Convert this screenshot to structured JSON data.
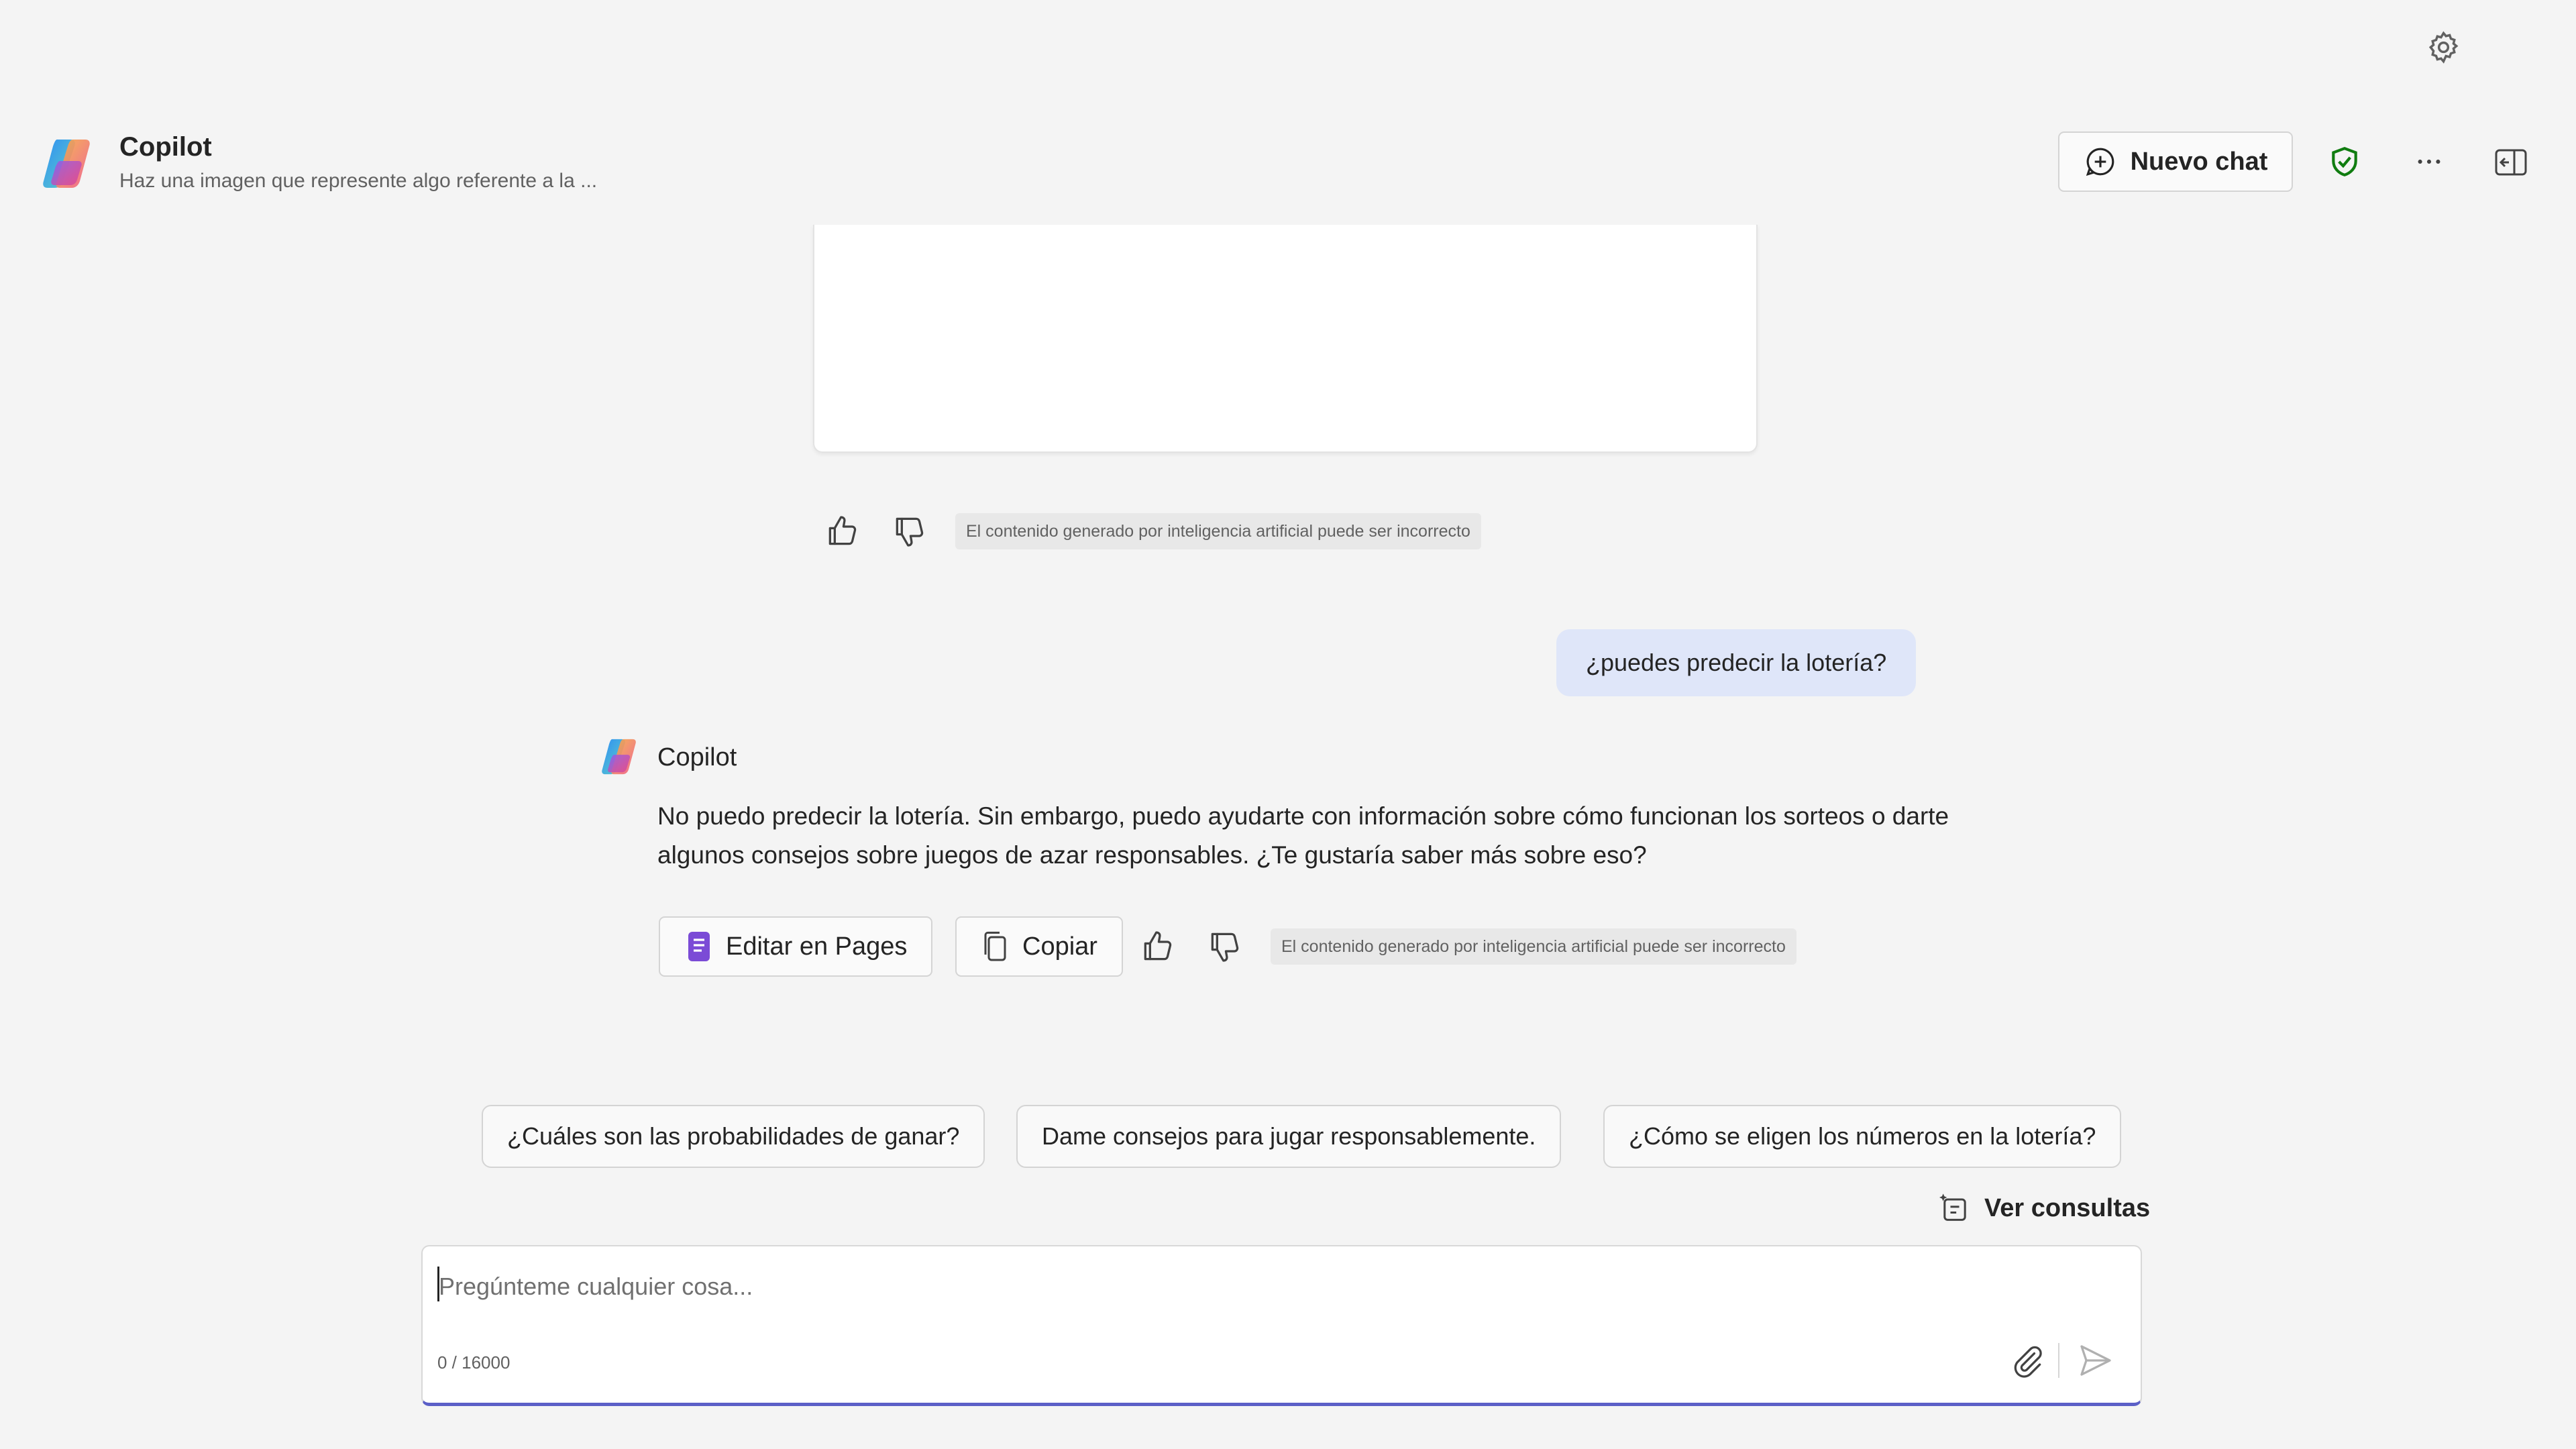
{
  "header": {
    "app_title": "Copilot",
    "subtitle": "Haz una imagen que represente algo referente a la ...",
    "new_chat_label": "Nuevo chat"
  },
  "previous_feedback": {
    "disclaimer": "El contenido generado por inteligencia artificial puede ser incorrecto"
  },
  "user_message": "¿puedes predecir la lotería?",
  "reply": {
    "sender": "Copilot",
    "text": "No puedo predecir la lotería. Sin embargo, puedo ayudarte con información sobre cómo funcionan los sorteos o darte algunos consejos sobre juegos de azar responsables. ¿Te gustaría saber más sobre eso?",
    "edit_in_pages_label": "Editar en Pages",
    "copy_label": "Copiar",
    "disclaimer": "El contenido generado por inteligencia artificial puede ser incorrecto"
  },
  "suggestions": [
    "¿Cuáles son las probabilidades de ganar?",
    "Dame consejos para jugar responsablemente.",
    "¿Cómo se eligen los números en la lotería?"
  ],
  "view_queries_label": "Ver consultas",
  "composer": {
    "placeholder": "Pregúnteme cualquier cosa...",
    "char_count": "0 / 16000"
  },
  "colors": {
    "background": "#f4f4f4",
    "user_bubble": "#dfe6f9",
    "accent": "#5b5fc7",
    "shield_green": "#107c10",
    "pages_purple": "#7b4bd6"
  },
  "icons": [
    "settings-icon",
    "copilot-logo",
    "new-chat-icon",
    "shield-check-icon",
    "more-icon",
    "side-panel-icon",
    "thumbs-up-icon",
    "thumbs-down-icon",
    "pages-icon",
    "copy-icon",
    "view-queries-icon",
    "attach-icon",
    "send-icon"
  ]
}
